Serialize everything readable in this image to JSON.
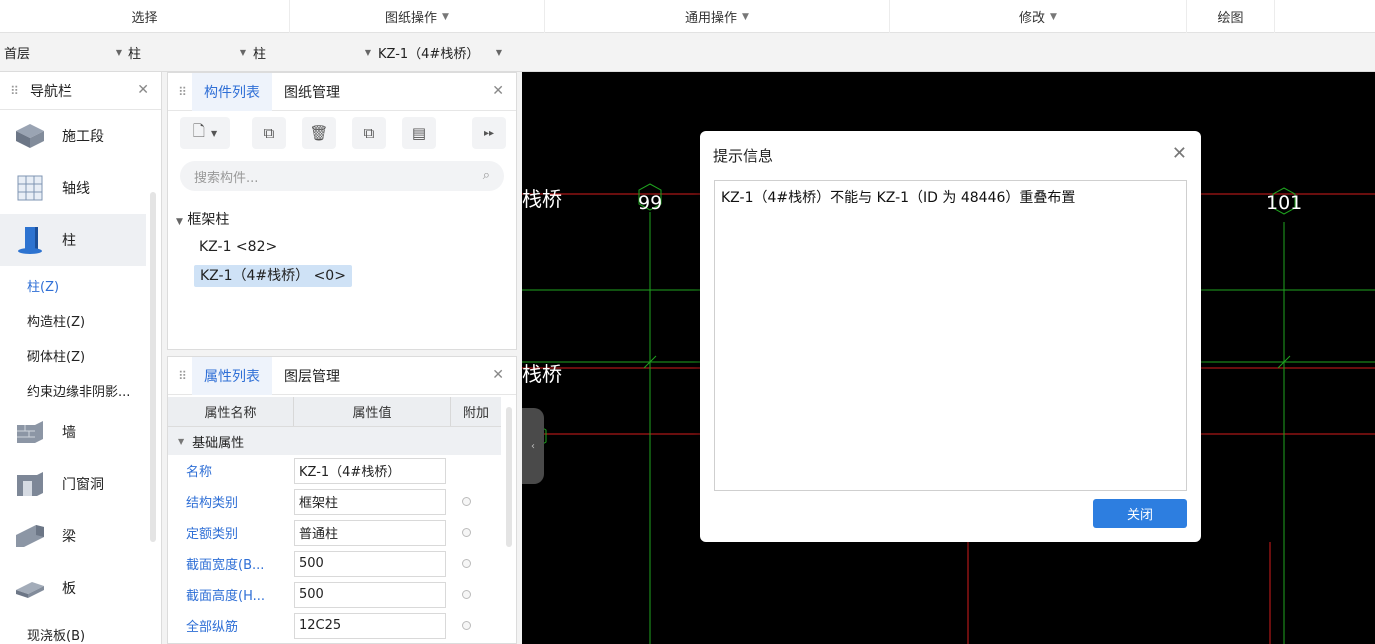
{
  "ribbon": {
    "groups": [
      {
        "label": "选择",
        "dropdown": false
      },
      {
        "label": "图纸操作",
        "dropdown": true
      },
      {
        "label": "通用操作",
        "dropdown": true
      },
      {
        "label": "修改",
        "dropdown": true
      },
      {
        "label": "绘图",
        "dropdown": false
      }
    ]
  },
  "selectors": {
    "floor": "首层",
    "type": "柱",
    "subtype": "柱",
    "component": "KZ-1（4#栈桥）"
  },
  "nav": {
    "title": "导航栏",
    "items": [
      {
        "label": "施工段",
        "icon": "construction-stage-icon"
      },
      {
        "label": "轴线",
        "icon": "axis-grid-icon"
      },
      {
        "label": "柱",
        "icon": "column-icon"
      },
      {
        "label": "墙",
        "icon": "wall-icon"
      },
      {
        "label": "门窗洞",
        "icon": "door-window-icon"
      },
      {
        "label": "梁",
        "icon": "beam-icon"
      },
      {
        "label": "板",
        "icon": "slab-icon"
      }
    ],
    "column_subitems": [
      "柱(Z)",
      "构造柱(Z)",
      "砌体柱(Z)",
      "约束边缘非阴影..."
    ],
    "slab_subitems": [
      "现浇板(B)"
    ]
  },
  "component_panel": {
    "tabs": [
      "构件列表",
      "图纸管理"
    ],
    "search_placeholder": "搜索构件...",
    "tree": {
      "group": "框架柱",
      "items": [
        "KZ-1 <82>",
        "KZ-1（4#栈桥） <0>"
      ]
    }
  },
  "property_panel": {
    "tabs": [
      "属性列表",
      "图层管理"
    ],
    "columns": [
      "属性名称",
      "属性值",
      "附加"
    ],
    "group": "基础属性",
    "rows": [
      {
        "name": "名称",
        "value": "KZ-1（4#栈桥）",
        "extra": false
      },
      {
        "name": "结构类别",
        "value": "框架柱",
        "extra": true
      },
      {
        "name": "定额类别",
        "value": "普通柱",
        "extra": true
      },
      {
        "name": "截面宽度(B...",
        "value": "500",
        "extra": true
      },
      {
        "name": "截面高度(H...",
        "value": "500",
        "extra": true
      },
      {
        "name": "全部纵筋",
        "value": "12C25",
        "extra": true
      }
    ]
  },
  "canvas": {
    "labels": [
      "栈桥",
      "栈桥"
    ],
    "axis_numbers": [
      "99",
      "101"
    ]
  },
  "dialog": {
    "title": "提示信息",
    "message": "KZ-1（4#栈桥）不能与 KZ-1（ID 为 48446）重叠布置",
    "close_button": "关闭"
  },
  "colors": {
    "accent": "#2f6fd6",
    "button": "#2d7ee0",
    "grid_green": "#1fa31f",
    "grid_red": "#d41c1c"
  }
}
